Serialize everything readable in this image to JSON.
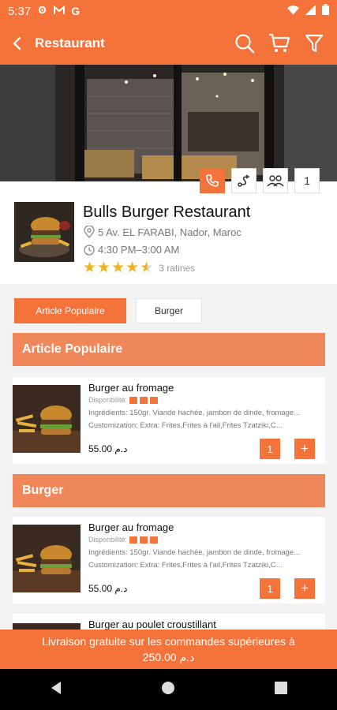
{
  "status_bar": {
    "time": "5:37"
  },
  "app_bar": {
    "title": "Restaurant"
  },
  "hero": {
    "count": "1"
  },
  "restaurant": {
    "name": "Bulls Burger Restaurant",
    "address": "5 Av. EL FARABI, Nador, Maroc",
    "hours": "4:30 PM–3:00 AM",
    "rating": 4.5,
    "rating_text": "3 ratines"
  },
  "tabs": [
    {
      "label": "Article Populaire",
      "active": true
    },
    {
      "label": "Burger",
      "active": false
    }
  ],
  "sections": [
    {
      "title": "Article Populaire",
      "items": [
        {
          "title": "Burger au fromage",
          "dispo_label": "Disponbilité:",
          "ingredients": "Ingrédients: 150gr. Viande hachée, jambon de dinde, fromage...",
          "customization": "Customization: Extra: Frites,Frites à l'ail,Frites Tzatziki,C...",
          "price": "55.00 د.م",
          "qty": "1",
          "add": "+"
        }
      ]
    },
    {
      "title": "Burger",
      "items": [
        {
          "title": "Burger au fromage",
          "dispo_label": "Disponbilité:",
          "ingredients": "Ingrédients: 150gr. Viande hachée, jambon de dinde, fromage...",
          "customization": "Customization: Extra: Frites,Frites à l'ail,Frites Tzatziki,C...",
          "price": "55.00 د.م",
          "qty": "1",
          "add": "+"
        },
        {
          "title": "Burger au poulet croustillant"
        }
      ]
    }
  ],
  "footer": {
    "line1": "Livraison gratuite sur les commandes supérieures à",
    "line2": "د.م 250.00"
  },
  "colors": {
    "accent": "#f4733b",
    "section": "#f0875a",
    "star": "#f2b21c"
  }
}
